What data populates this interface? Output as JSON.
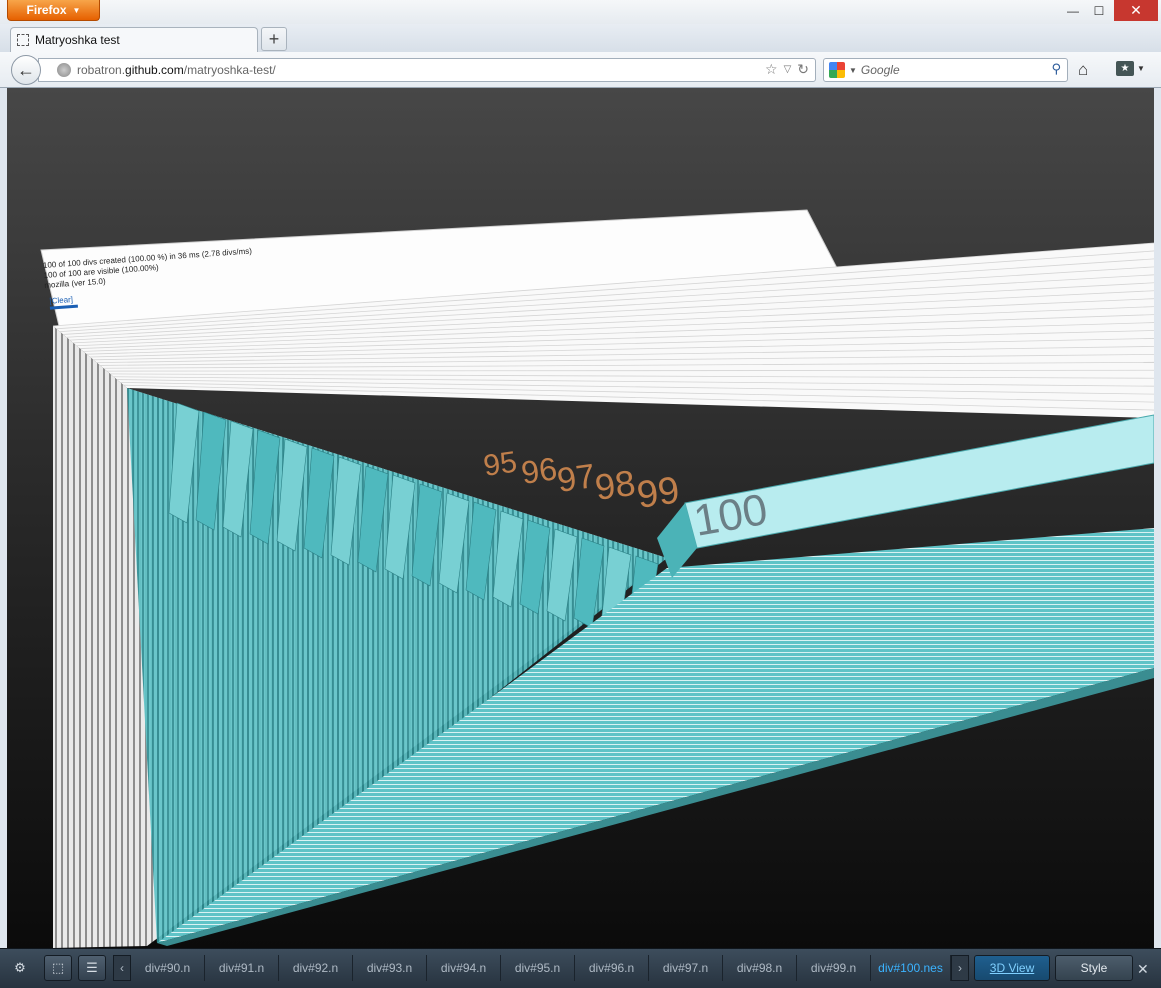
{
  "browser": {
    "app_button": "Firefox",
    "window_controls": {
      "minimize": "—",
      "maximize": "☐",
      "close": "✕"
    }
  },
  "tabs": [
    {
      "title": "Matryoshka test"
    }
  ],
  "new_tab_label": "+",
  "address": {
    "prefix": "robatron.",
    "domain": "github.com",
    "path": "/matryoshka-test/"
  },
  "search": {
    "placeholder": "Google"
  },
  "page": {
    "stats": [
      "100 of 100 divs created (100.00 %) in 36 ms (2.78 divs/ms)",
      "100 of 100 are visible (100.00%)",
      "mozilla (ver 15.0)"
    ],
    "clear_label": "[Clear]",
    "visible_numbers": [
      "95",
      "96",
      "97",
      "98",
      "99",
      "100"
    ]
  },
  "devtools": {
    "breadcrumbs": [
      "div#90.n",
      "div#91.n",
      "div#92.n",
      "div#93.n",
      "div#94.n",
      "div#95.n",
      "div#96.n",
      "div#97.n",
      "div#98.n",
      "div#99.n",
      "div#100.nes"
    ],
    "selected_index": 10,
    "view_3d": "3D View",
    "style": "Style",
    "close": "✕"
  },
  "colors": {
    "accent_teal": "#5fc3c7",
    "inner_box": "#b8ecef",
    "selected_crumb": "#3bb3ff",
    "firefox_orange": "#e66000"
  }
}
